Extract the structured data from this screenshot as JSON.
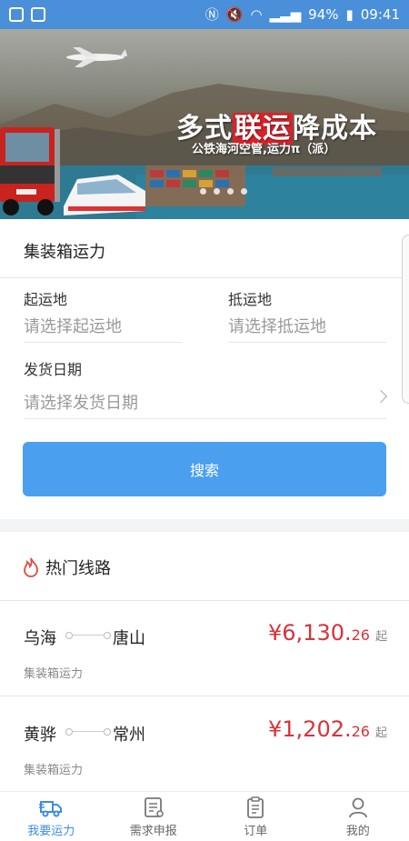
{
  "status_bar": {
    "battery": "94%",
    "time": "09:41",
    "left_icons": [
      "briefcase-icon",
      "paw-icon"
    ],
    "right_icons": [
      "nfc-icon",
      "mute-icon",
      "wifi-icon",
      "signal-icon",
      "battery-icon"
    ]
  },
  "banner": {
    "title_pre": "多式",
    "title_highlight": "联运",
    "title_post": "降成本",
    "subtitle": "公铁海河空管,运力π（派）",
    "dot_count": 4
  },
  "form": {
    "section_title": "集装箱运力",
    "origin_label": "起运地",
    "origin_placeholder": "请选择起运地",
    "destination_label": "抵运地",
    "destination_placeholder": "请选择抵运地",
    "date_label": "发货日期",
    "date_placeholder": "请选择发货日期",
    "search_button": "搜索"
  },
  "hot_routes": {
    "title": "热门线路",
    "routes": [
      {
        "from": "乌海",
        "to": "唐山",
        "price_main": "¥6,130.",
        "price_decimal": "26",
        "price_suffix": "起",
        "type": "集装箱运力"
      },
      {
        "from": "黄骅",
        "to": "常州",
        "price_main": "¥1,202.",
        "price_decimal": "26",
        "price_suffix": "起",
        "type": "集装箱运力"
      }
    ]
  },
  "tabbar": {
    "tabs": [
      {
        "label": "我要运力",
        "icon": "truck-icon",
        "active": true
      },
      {
        "label": "需求申报",
        "icon": "document-icon",
        "active": false
      },
      {
        "label": "订单",
        "icon": "clipboard-icon",
        "active": false
      },
      {
        "label": "我的",
        "icon": "user-icon",
        "active": false
      }
    ]
  },
  "colors": {
    "accent": "#4aa0ef",
    "status_bar": "#4a8fd9",
    "price": "#d8323a",
    "tab_active": "#3d8ee0"
  }
}
